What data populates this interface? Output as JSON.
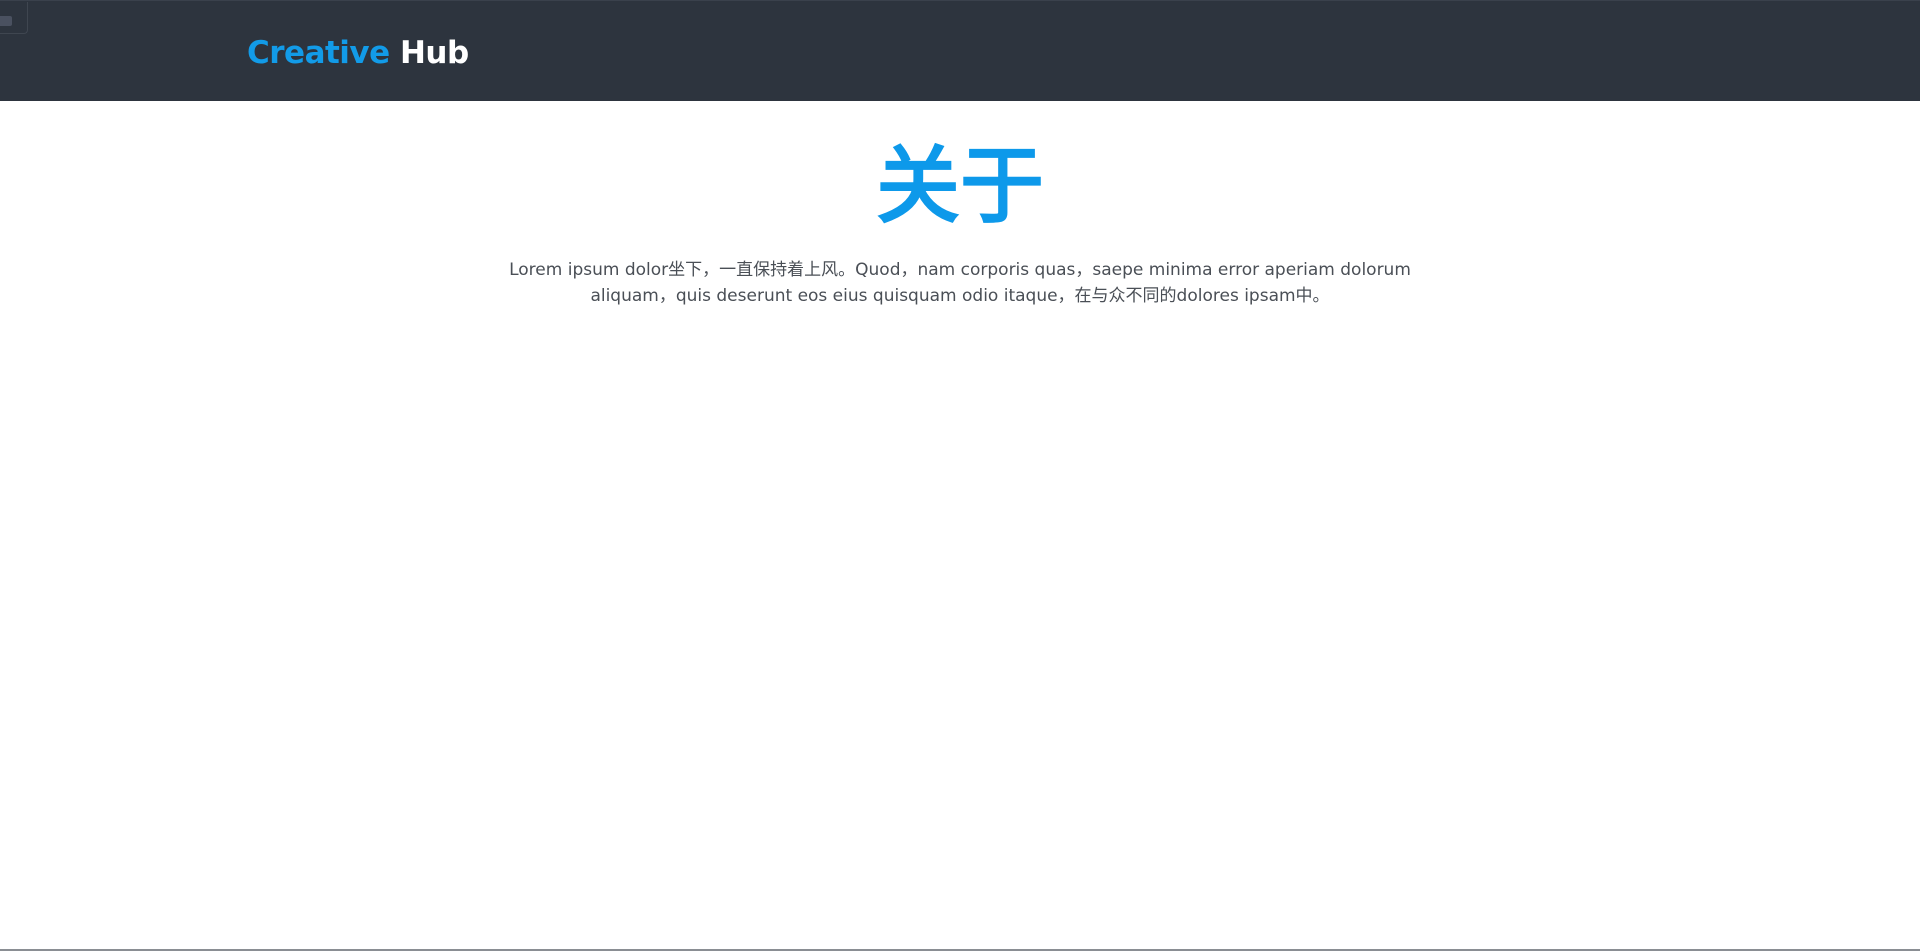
{
  "header": {
    "brand_primary": "Creative",
    "brand_secondary": "Hub",
    "background_color": "#2d343e",
    "brand_accent_color": "#129be8"
  },
  "about": {
    "title": "关于",
    "body": "Lorem ipsum dolor坐下，一直保持着上风。Quod，nam corporis quas，saepe minima error aperiam dolorum aliquam，quis deserunt eos eius quisquam odio itaque，在与众不同的dolores ipsam中。",
    "title_color": "#0d99ea"
  }
}
